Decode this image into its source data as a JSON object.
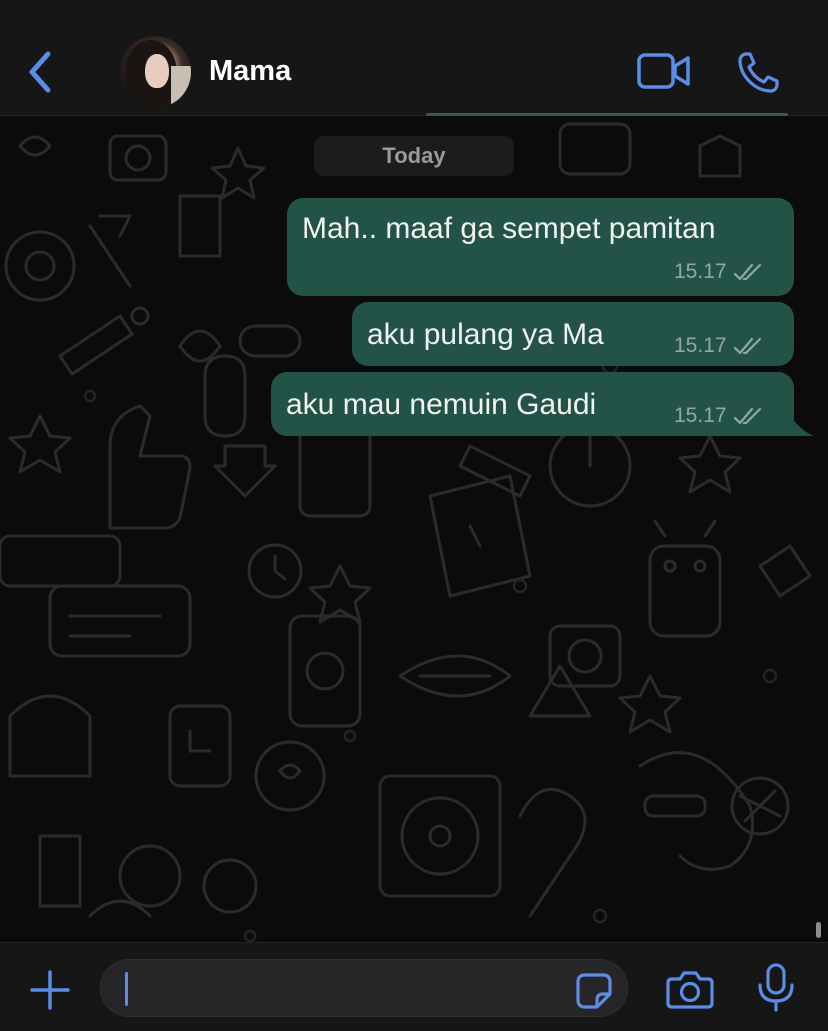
{
  "header": {
    "contact_name": "Mama",
    "icons": {
      "back": "chevron-left-icon",
      "video": "video-camera-icon",
      "call": "phone-icon"
    }
  },
  "chat": {
    "date_separator": "Today",
    "messages": [
      {
        "text": "Mah.. maaf ga sempet pamitan",
        "time": "15.17",
        "status": "read"
      },
      {
        "text": "aku pulang ya Ma",
        "time": "15.17",
        "status": "read"
      },
      {
        "text": "aku mau nemuin Gaudi",
        "time": "15.17",
        "status": "read"
      }
    ]
  },
  "composer": {
    "value": "",
    "icons": {
      "attach": "plus-icon",
      "sticker": "sticker-icon",
      "camera": "camera-icon",
      "mic": "microphone-icon"
    }
  },
  "colors": {
    "accent": "#5b8de8",
    "bubble_outgoing": "#235347",
    "header_bg": "#161616",
    "chat_bg": "#0b0b0b"
  }
}
